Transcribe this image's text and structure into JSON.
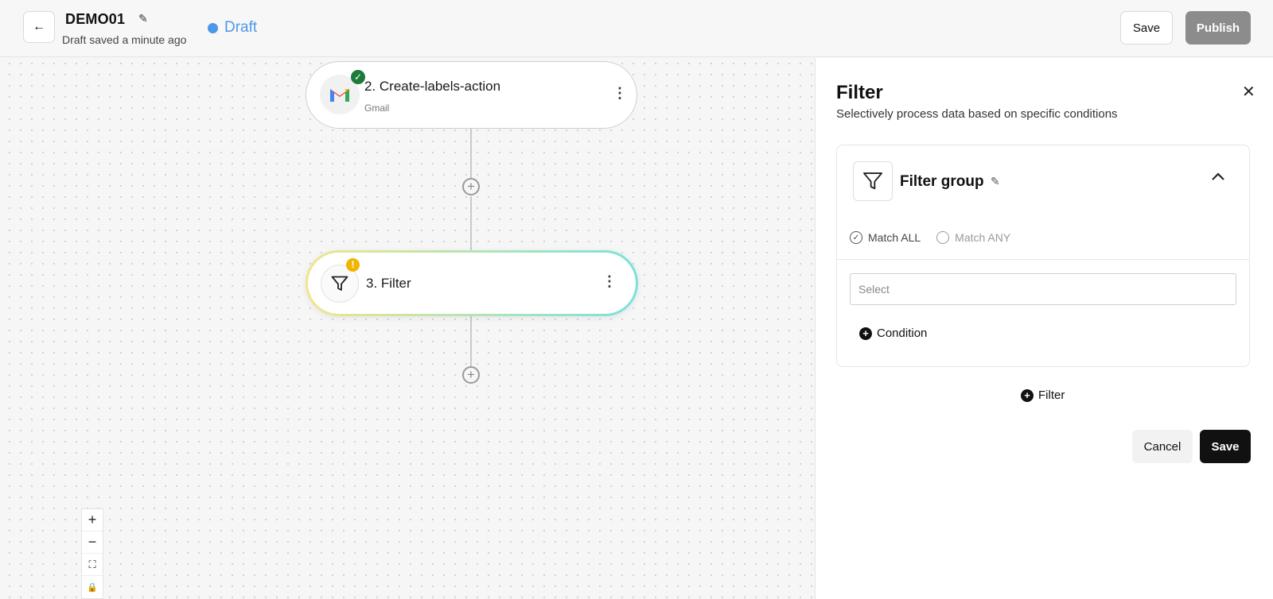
{
  "header": {
    "back_icon": "←",
    "workflow_name": "DEMO01",
    "edit_icon": "✎",
    "saved_status": "Draft saved a minute ago",
    "status_label": "Draft",
    "status_color": "#4d97e8",
    "save_label": "Save",
    "publish_label": "Publish"
  },
  "canvas": {
    "nodes": [
      {
        "title": "2. Create-labels-action",
        "subtitle": "Gmail",
        "icon": "gmail-icon",
        "status_icon": "✓",
        "menu": "⋮"
      },
      {
        "title": "3. Filter",
        "icon": "filter-icon",
        "status_icon": "!",
        "menu": "⋮"
      }
    ],
    "add_step_icon": "+",
    "zoom": {
      "in": "+",
      "out": "−",
      "fit": "⛶",
      "lock": "🔒"
    }
  },
  "panel": {
    "title": "Filter",
    "subtitle": "Selectively process data based on specific conditions",
    "close_icon": "✕",
    "group": {
      "name": "Filter group",
      "edit_icon": "✎",
      "collapse_icon": "⌃",
      "match_all": "Match ALL",
      "match_any": "Match ANY",
      "selected_match": "Match ALL",
      "select_placeholder": "Select",
      "add_condition": "Condition"
    },
    "add_filter": "Filter",
    "cancel_label": "Cancel",
    "save_label": "Save"
  }
}
